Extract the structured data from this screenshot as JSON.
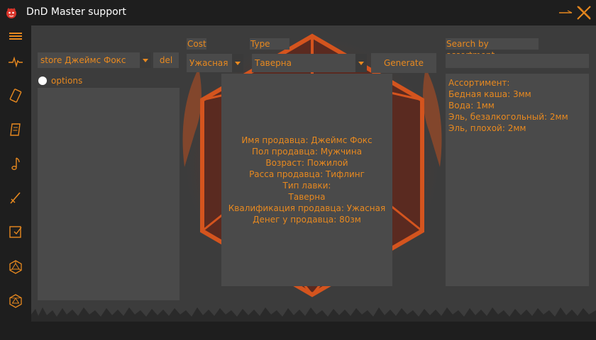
{
  "window": {
    "title": "DnD Master support"
  },
  "sidebar": {
    "icons": [
      "menu-icon",
      "pulse-icon",
      "card-icon",
      "scroll-icon",
      "music-icon",
      "sword-icon",
      "checkbox-icon",
      "d20-icon",
      "d20-outline-icon"
    ]
  },
  "store": {
    "selected": "store Джеймс Фокс",
    "del_label": "del"
  },
  "options": {
    "label": "options"
  },
  "cost": {
    "label": "Cost",
    "selected": "Ужасная"
  },
  "type": {
    "label": "Type",
    "selected": "Таверна"
  },
  "generate": {
    "label": "Generate"
  },
  "search": {
    "label": "Search by assortment",
    "value": ""
  },
  "info": {
    "lines": [
      "Имя продавца: Джеймс Фокс",
      "Пол продавца: Мужчина",
      "Возраст: Пожилой",
      "Расса продавца: Тифлинг",
      "Тип лавки:",
      "Таверна",
      "Квалификация продавца: Ужасная",
      "Денег у продавца: 80зм"
    ]
  },
  "assortment": {
    "lines": [
      "Ассортимент:",
      "Бедная каша: 3мм",
      "Вода: 1мм",
      "Эль, безалкогольный: 2мм",
      "Эль, плохой: 2мм"
    ]
  },
  "colors": {
    "accent": "#e8891f",
    "panel": "#4a4a4a",
    "background": "#3c3c3c",
    "chrome": "#1e1e1e"
  }
}
